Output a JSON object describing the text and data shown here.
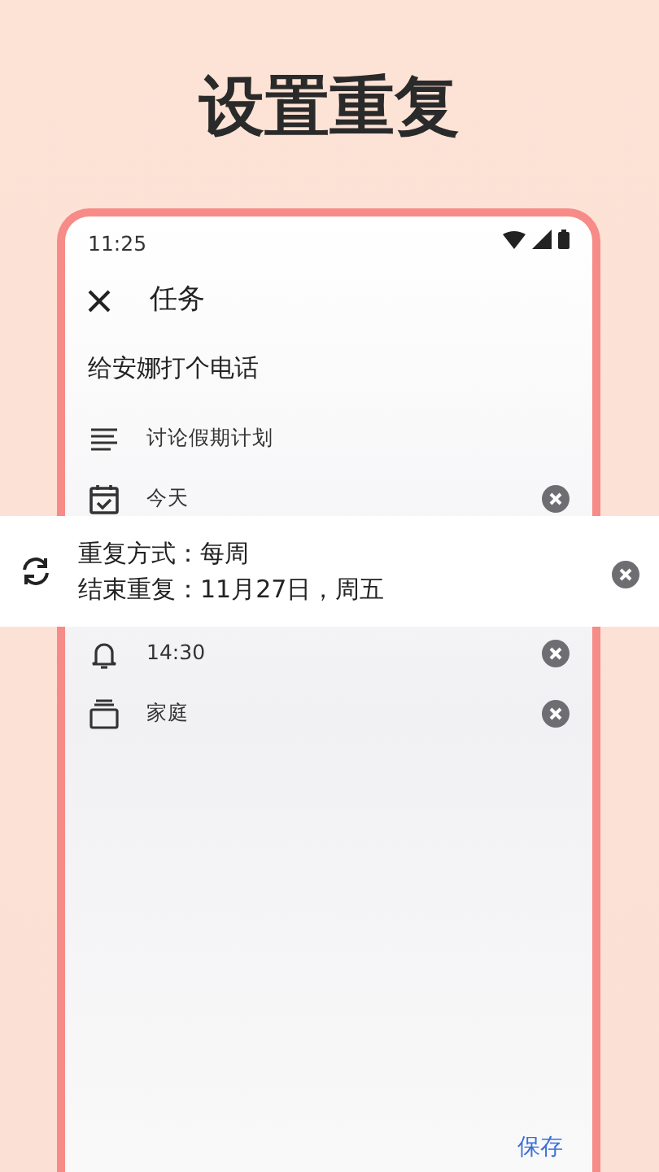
{
  "headline": "设置重复",
  "status_bar": {
    "time": "11:25"
  },
  "toolbar": {
    "title": "任务"
  },
  "task": {
    "title": "给安娜打个电话"
  },
  "rows": [
    {
      "kind": "notes",
      "text": "讨论假期计划",
      "clearable": false
    },
    {
      "kind": "date",
      "text": "今天",
      "clearable": true
    },
    {
      "kind": "reminder",
      "text": "14:30",
      "clearable": true
    },
    {
      "kind": "category",
      "text": "家庭",
      "clearable": true
    }
  ],
  "repeat_popup": {
    "lines": [
      "重复方式：每周",
      "结束重复：11月27日，周五"
    ],
    "clearable": true
  },
  "save_button": "保存"
}
